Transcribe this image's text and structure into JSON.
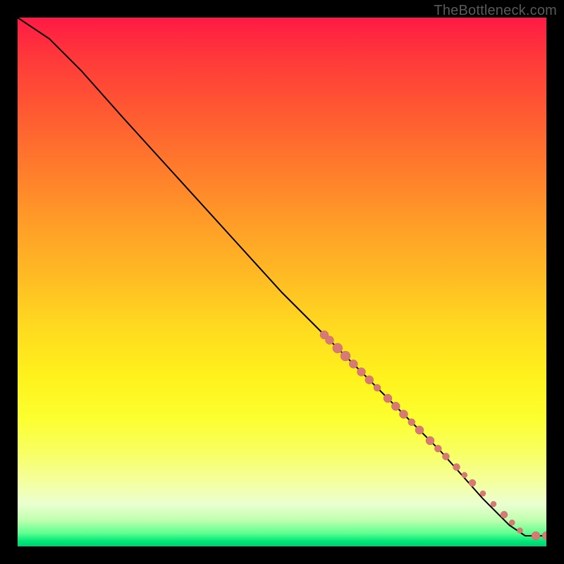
{
  "watermark": "TheBottleneck.com",
  "colors": {
    "curve": "#000000",
    "point_fill": "#d87a74",
    "point_stroke": "#c86a64",
    "gradient_top": "#ff1a44",
    "gradient_bottom": "#00d070"
  },
  "chart_data": {
    "type": "line",
    "title": "",
    "xlabel": "",
    "ylabel": "",
    "xlim": [
      0,
      100
    ],
    "ylim": [
      0,
      100
    ],
    "curve": [
      {
        "x": 0,
        "y": 100
      },
      {
        "x": 6,
        "y": 96
      },
      {
        "x": 12,
        "y": 90
      },
      {
        "x": 20,
        "y": 81
      },
      {
        "x": 30,
        "y": 70
      },
      {
        "x": 40,
        "y": 59
      },
      {
        "x": 50,
        "y": 48
      },
      {
        "x": 60,
        "y": 38
      },
      {
        "x": 70,
        "y": 28
      },
      {
        "x": 80,
        "y": 18
      },
      {
        "x": 88,
        "y": 9
      },
      {
        "x": 93,
        "y": 4
      },
      {
        "x": 96,
        "y": 2
      },
      {
        "x": 98,
        "y": 2
      },
      {
        "x": 100,
        "y": 2
      }
    ],
    "points": [
      {
        "x": 58,
        "y": 40,
        "r": 6
      },
      {
        "x": 59,
        "y": 39,
        "r": 6
      },
      {
        "x": 60.5,
        "y": 37.5,
        "r": 7
      },
      {
        "x": 62,
        "y": 36,
        "r": 7
      },
      {
        "x": 63.5,
        "y": 34.5,
        "r": 6
      },
      {
        "x": 65,
        "y": 33,
        "r": 6
      },
      {
        "x": 66.5,
        "y": 31.5,
        "r": 6
      },
      {
        "x": 68,
        "y": 30,
        "r": 5
      },
      {
        "x": 70,
        "y": 28,
        "r": 6
      },
      {
        "x": 71.5,
        "y": 26.5,
        "r": 6
      },
      {
        "x": 73,
        "y": 25,
        "r": 6
      },
      {
        "x": 74.5,
        "y": 23.5,
        "r": 5
      },
      {
        "x": 76,
        "y": 22,
        "r": 6
      },
      {
        "x": 78,
        "y": 20,
        "r": 6
      },
      {
        "x": 79.5,
        "y": 18.5,
        "r": 5
      },
      {
        "x": 81,
        "y": 17,
        "r": 5
      },
      {
        "x": 83,
        "y": 15,
        "r": 5
      },
      {
        "x": 84.5,
        "y": 13.5,
        "r": 4
      },
      {
        "x": 86,
        "y": 12,
        "r": 5
      },
      {
        "x": 88,
        "y": 10,
        "r": 4
      },
      {
        "x": 90,
        "y": 8,
        "r": 4
      },
      {
        "x": 92,
        "y": 6,
        "r": 5
      },
      {
        "x": 93.5,
        "y": 4.5,
        "r": 4
      },
      {
        "x": 95,
        "y": 3,
        "r": 4
      },
      {
        "x": 98,
        "y": 2,
        "r": 6
      },
      {
        "x": 100,
        "y": 2,
        "r": 6
      }
    ]
  }
}
